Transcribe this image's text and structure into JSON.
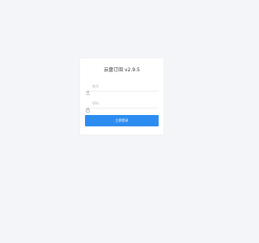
{
  "app": {
    "title": "云盘订阅 v2.9.5"
  },
  "form": {
    "username_placeholder": "账号",
    "password_placeholder": "密码",
    "submit_label": "立即登录"
  },
  "icons": {
    "username": "user-icon",
    "password": "lock-icon"
  },
  "colors": {
    "background": "#f4f5f8",
    "card": "#ffffff",
    "primary_button": "#2d8cf0"
  }
}
